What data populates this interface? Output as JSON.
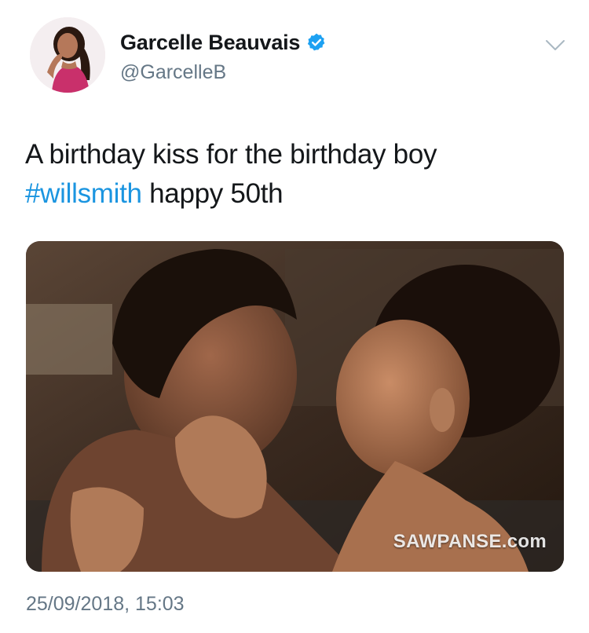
{
  "profile": {
    "display_name": "Garcelle Beauvais",
    "handle": "@GarcelleB",
    "verified": true
  },
  "tweet": {
    "text_line1": "A birthday kiss for the birthday boy",
    "hashtag": "#willsmith",
    "text_after_hashtag": " happy 50th",
    "timestamp": "25/09/2018, 15:03"
  },
  "media": {
    "watermark": "SAWPANSE.com"
  },
  "icons": {
    "verified_badge": "verified-check-icon",
    "more_menu": "chevron-down-icon"
  },
  "colors": {
    "link": "#1b95e0",
    "secondary_text": "#657786",
    "primary_text": "#14171a",
    "verified": "#1da1f2"
  }
}
